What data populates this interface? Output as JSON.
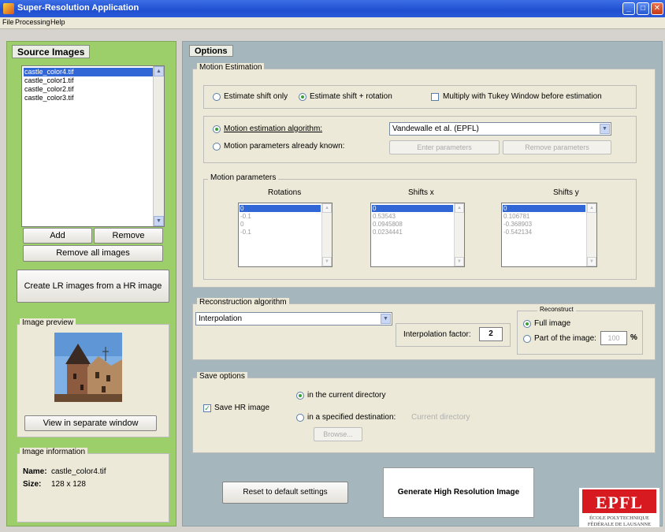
{
  "window": {
    "title": "Super-Resolution Application"
  },
  "menu": [
    "File",
    "Processing",
    "Help"
  ],
  "colors": {
    "left_panel": "#9ccf6a",
    "options_panel": "#a5b6bc",
    "selection": "#3166d6",
    "epfl_red": "#d71920"
  },
  "source": {
    "title": "Source Images",
    "files": [
      "castle_color4.tif",
      "castle_color1.tif",
      "castle_color2.tif",
      "castle_color3.tif"
    ],
    "selected_index": 0,
    "add": "Add",
    "remove": "Remove",
    "remove_all": "Remove all images",
    "create_lr": "Create LR images from a HR image"
  },
  "preview": {
    "title": "Image preview",
    "view_button": "View in separate window"
  },
  "info": {
    "title": "Image information",
    "name_label": "Name:",
    "name_value": "castle_color4.tif",
    "size_label": "Size:",
    "size_value": "128 x 128"
  },
  "options": {
    "title": "Options",
    "motion": {
      "title": "Motion Estimation",
      "shift_only": "Estimate shift only",
      "shift_rotation": "Estimate shift + rotation",
      "selected_mode": "shift_rotation",
      "tukey": "Multiply with Tukey Window before estimation",
      "tukey_checked": false,
      "algo_label": "Motion estimation algorithm:",
      "algo_value": "Vandewalle et al. (EPFL)",
      "known_label": "Motion parameters already known:",
      "selected_source": "algorithm",
      "enter_params": "Enter parameters",
      "remove_params": "Remove parameters"
    },
    "params": {
      "title": "Motion parameters",
      "rotations_label": "Rotations",
      "shiftx_label": "Shifts x",
      "shifty_label": "Shifts y",
      "rotations": [
        "0",
        "-0.1",
        "0",
        "-0.1"
      ],
      "shiftx": [
        "0",
        "0.53543",
        "0.0945808",
        "0.0234441"
      ],
      "shifty": [
        "0",
        "0.106781",
        "-0.368903",
        "-0.542134"
      ]
    },
    "recon": {
      "title": "Reconstruction algorithm",
      "algo_value": "Interpolation",
      "factor_label": "Interpolation factor:",
      "factor_value": "2",
      "reconstruct_title": "Reconstruct",
      "full_image": "Full image",
      "part_image": "Part of the image:",
      "part_value": "100",
      "percent": "%",
      "selected": "full"
    },
    "save": {
      "title": "Save options",
      "save_hr": "Save HR image",
      "save_hr_checked": true,
      "current_dir": "in the current directory",
      "specified": "in a specified destination:",
      "current_dir_hint": "Current directory",
      "browse": "Browse..."
    },
    "reset": "Reset to default settings",
    "generate": "Generate High Resolution Image"
  },
  "logo": {
    "text": "EPFL",
    "line1": "ÉCOLE POLYTECHNIQUE",
    "line2": "FÉDÉRALE DE LAUSANNE"
  }
}
